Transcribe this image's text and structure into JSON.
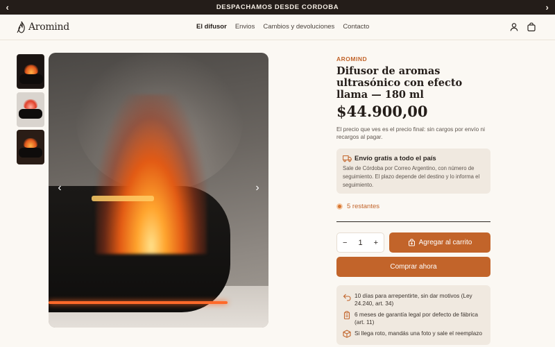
{
  "announcement": {
    "text": "DESPACHAMOS DESDE CORDOBA",
    "prev": "‹",
    "next": "›"
  },
  "header": {
    "logo": "Aromind",
    "nav": [
      "El difusor",
      "Envios",
      "Cambios y devoluciones",
      "Contacto"
    ],
    "active_nav": "El difusor",
    "icons": [
      "account-icon",
      "cart-icon"
    ]
  },
  "gallery": {
    "thumbnails": 3,
    "selected": 1,
    "prev": "‹",
    "next": "›"
  },
  "product": {
    "brand": "AROMIND",
    "title": "Difusor de aromas ultrasónico con efecto llama — 180 ml",
    "price": "$44.900,00",
    "price_note": "El precio que ves es el precio final: sin cargos por envío ni recargos al pagar.",
    "shipping": {
      "title": "Envío gratis a todo el país",
      "text": "Sale de Córdoba por Correo Argentino, con número de seguimiento. El plazo depende del destino y lo informa el seguimiento."
    },
    "stock": "5 restantes",
    "quantity": {
      "minus": "−",
      "value": "1",
      "plus": "+"
    },
    "add_to_cart": "Agregar al carrito",
    "buy_now": "Comprar ahora",
    "perks": [
      "10 días para arrepentirte, sin dar motivos (Ley 24.240, art. 34)",
      "6 meses de garantía legal por defecto de fábrica (art. 11)",
      "Si llega roto, mandás una foto y sale el reemplazo"
    ]
  },
  "colors": {
    "accent": "#c2642a",
    "dark": "#241d19",
    "background": "#fbf8f3",
    "panel": "#f0e9e0"
  }
}
